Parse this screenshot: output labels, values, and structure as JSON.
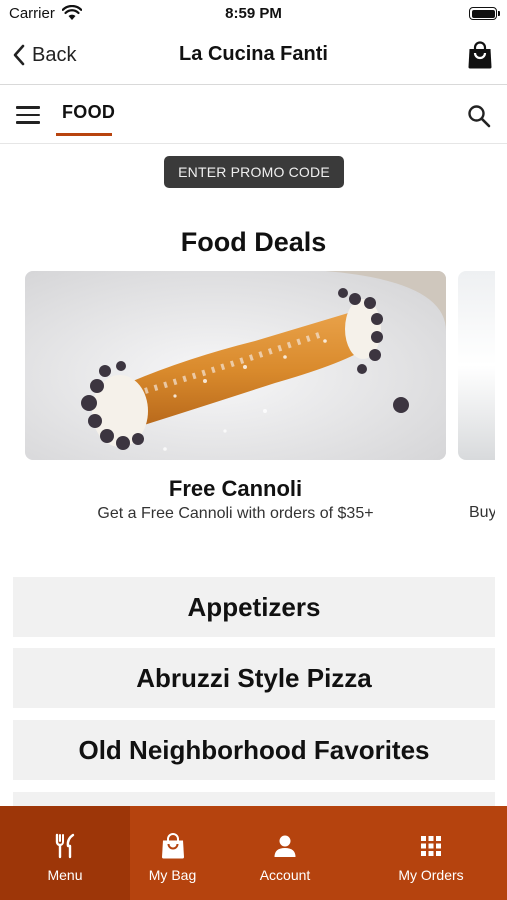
{
  "status_bar": {
    "carrier": "Carrier",
    "time": "8:59 PM"
  },
  "nav": {
    "back_label": "Back",
    "title": "La Cucina Fanti"
  },
  "category": {
    "active_tab": "FOOD"
  },
  "promo": {
    "label": "ENTER PROMO CODE"
  },
  "deals": {
    "title": "Food Deals",
    "items": [
      {
        "name": "Free Cannoli",
        "description": "Get a Free Cannoli with orders of $35+"
      },
      {
        "name": "",
        "description": "Buy"
      }
    ]
  },
  "sections": [
    {
      "label": "Appetizers"
    },
    {
      "label": "Abruzzi Style Pizza"
    },
    {
      "label": "Old Neighborhood Favorites"
    }
  ],
  "tab_bar": {
    "tabs": [
      {
        "label": "Menu",
        "icon": "fork-knife-icon",
        "active": true
      },
      {
        "label": "My Bag",
        "icon": "shopping-bag-icon",
        "active": false
      },
      {
        "label": "Account",
        "icon": "person-icon",
        "active": false
      },
      {
        "label": "My Orders",
        "icon": "grid-icon",
        "active": false
      }
    ]
  },
  "colors": {
    "brand": "#b5430e",
    "brand_active": "#9d3608",
    "promo_bg": "#3a3a3a",
    "section_bg": "#f1f1f1"
  }
}
